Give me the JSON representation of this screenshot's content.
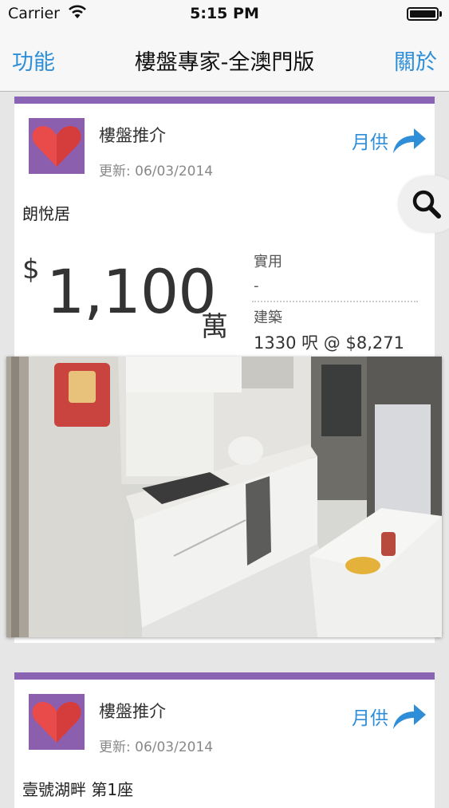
{
  "status_bar": {
    "carrier": "Carrier",
    "time": "5:15 PM"
  },
  "nav": {
    "left": "功能",
    "title": "樓盤專家-全澳門版",
    "right": "關於"
  },
  "listings": [
    {
      "category": "樓盤推介",
      "updated": "更新: 06/03/2014",
      "monthly_label": "月供",
      "name": "朗悅居",
      "currency": "$",
      "price": "1,100",
      "price_unit": "萬",
      "saleable_label": "實用",
      "saleable_value": "-",
      "gross_label": "建築",
      "gross_value": "1330 呎 @ $8,271"
    },
    {
      "category": "樓盤推介",
      "updated": "更新: 06/03/2014",
      "monthly_label": "月供",
      "name": "壹號湖畔 第1座"
    }
  ],
  "colors": {
    "accent": "#2e8ed8",
    "card_border": "#8b63b4",
    "heart": "#e84a4a",
    "tile": "#8c5eae"
  },
  "icons": {
    "favorite": "heart-icon",
    "share": "share-arrow-icon",
    "search": "search-icon"
  }
}
